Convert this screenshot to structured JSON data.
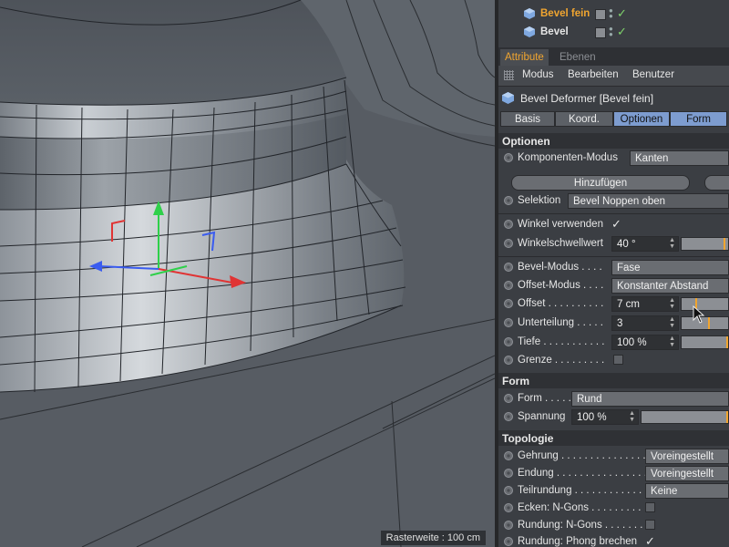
{
  "objects": [
    {
      "name": "Bevel fein"
    },
    {
      "name": "Bevel"
    }
  ],
  "tabs": {
    "attribute": "Attribute",
    "ebenen": "Ebenen"
  },
  "menu": {
    "modus": "Modus",
    "bearbeiten": "Bearbeiten",
    "benutzer": "Benutzer"
  },
  "object_title": "Bevel Deformer [Bevel fein]",
  "subtabs": [
    "Basis",
    "Koord.",
    "Optionen",
    "Form"
  ],
  "optionen": {
    "header": "Optionen",
    "komponenten_label": "Komponenten-Modus",
    "komponenten_value": "Kanten",
    "hinzufuegen": "Hinzufügen",
    "selektion_label": "Selektion",
    "selektion_value": "Bevel Noppen oben",
    "winkel_label": "Winkel verwenden",
    "winkel_check": "✓",
    "winkelschwelle_label": "Winkelschwellwert",
    "winkelschwelle_value": "40 °",
    "bevelmodus_label": "Bevel-Modus . . . .",
    "bevelmodus_value": "Fase",
    "offsetmodus_label": "Offset-Modus . . . .",
    "offsetmodus_value": "Konstanter Abstand",
    "offset_label": "Offset . . . . . . . . . .",
    "offset_value": "7 cm",
    "unterteilung_label": "Unterteilung . . . . .",
    "unterteilung_value": "3",
    "tiefe_label": "Tiefe . . . . . . . . . . .",
    "tiefe_value": "100 %",
    "grenze_label": "Grenze . . . . . . . . ."
  },
  "form": {
    "header": "Form",
    "form_label": "Form . . . . .",
    "form_value": "Rund",
    "spannung_label": "Spannung",
    "spannung_value": "100 %"
  },
  "topologie": {
    "header": "Topologie",
    "gehrung_label": "Gehrung . . . . . . . . . . . . . . .",
    "gehrung_value": "Voreingestellt",
    "endung_label": "Endung . . . . . . . . . . . . . . . .",
    "endung_value": "Voreingestellt",
    "teilrundung_label": "Teilrundung . . . . . . . . . . . . .",
    "teilrundung_value": "Keine",
    "ecken_label": "Ecken: N-Gons . . . . . . . . .",
    "rundung_label": "Rundung: N-Gons . . . . . . .",
    "phong_label": "Rundung: Phong brechen",
    "phong_check": "✓"
  },
  "viewport": {
    "raster": "Rasterweite : 100 cm"
  },
  "slider_levels": {
    "winkelschwelle": 0.94,
    "offset": 0.3,
    "unterteilung": 0.6,
    "tiefe": 1.0,
    "spannung": 1.0
  },
  "colors": {
    "accent": "#f0a530",
    "active_tab": "#7d9ccf",
    "panel": "#3b3e43",
    "viewport": "#565b62"
  }
}
